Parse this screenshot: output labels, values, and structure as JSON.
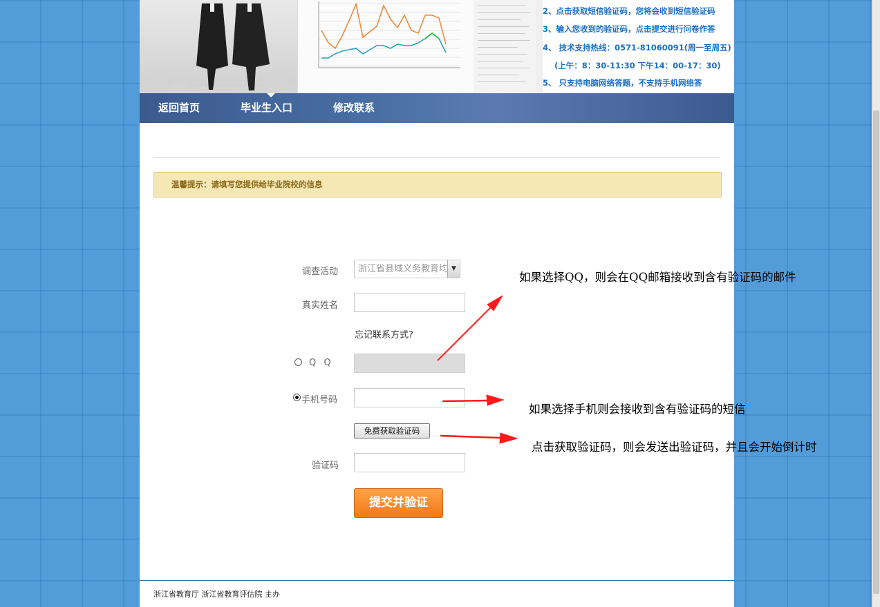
{
  "banner": {
    "steps": [
      "2、点击获取短信验证码，您将会收到短信验证码",
      "3、输入您收到的验证码，点击提交进行问卷作答",
      "4、 技术支持热线：0571-81060091(周一至周五)",
      "(上午：8：30-11:30 下午14：00-17：30)",
      "5、 只支持电脑网络答题，不支持手机网络答"
    ]
  },
  "nav": {
    "items": [
      "返回首页",
      "毕业生入口",
      "修改联系"
    ]
  },
  "notice": {
    "text": "温馨提示：请填写您提供给毕业院校的信息"
  },
  "form": {
    "survey_label": "调查活动",
    "survey_value": "浙江省县域义务教育均",
    "name_label": "真实姓名",
    "forgot_text": "忘记联系方式?",
    "qq_label": "Q  Q",
    "phone_label": "手机号码",
    "get_code_label": "免费获取验证码",
    "code_label": "验证码",
    "submit_label": "提交并验证",
    "contact_method": "phone"
  },
  "footer": {
    "text": "浙江省教育厅 浙江省教育评估院 主办"
  },
  "annotations": {
    "qq_note": "如果选择QQ，则会在QQ邮箱接收到含有验证码的邮件",
    "phone_note": "如果选择手机则会接收到含有验证码的短信",
    "code_note": "点击获取验证码，则会发送出验证码，并且会开始倒计时"
  },
  "colors": {
    "arrow": "#ff1a1a",
    "nav": "#4a6fa3",
    "submit": "#f27a16"
  }
}
